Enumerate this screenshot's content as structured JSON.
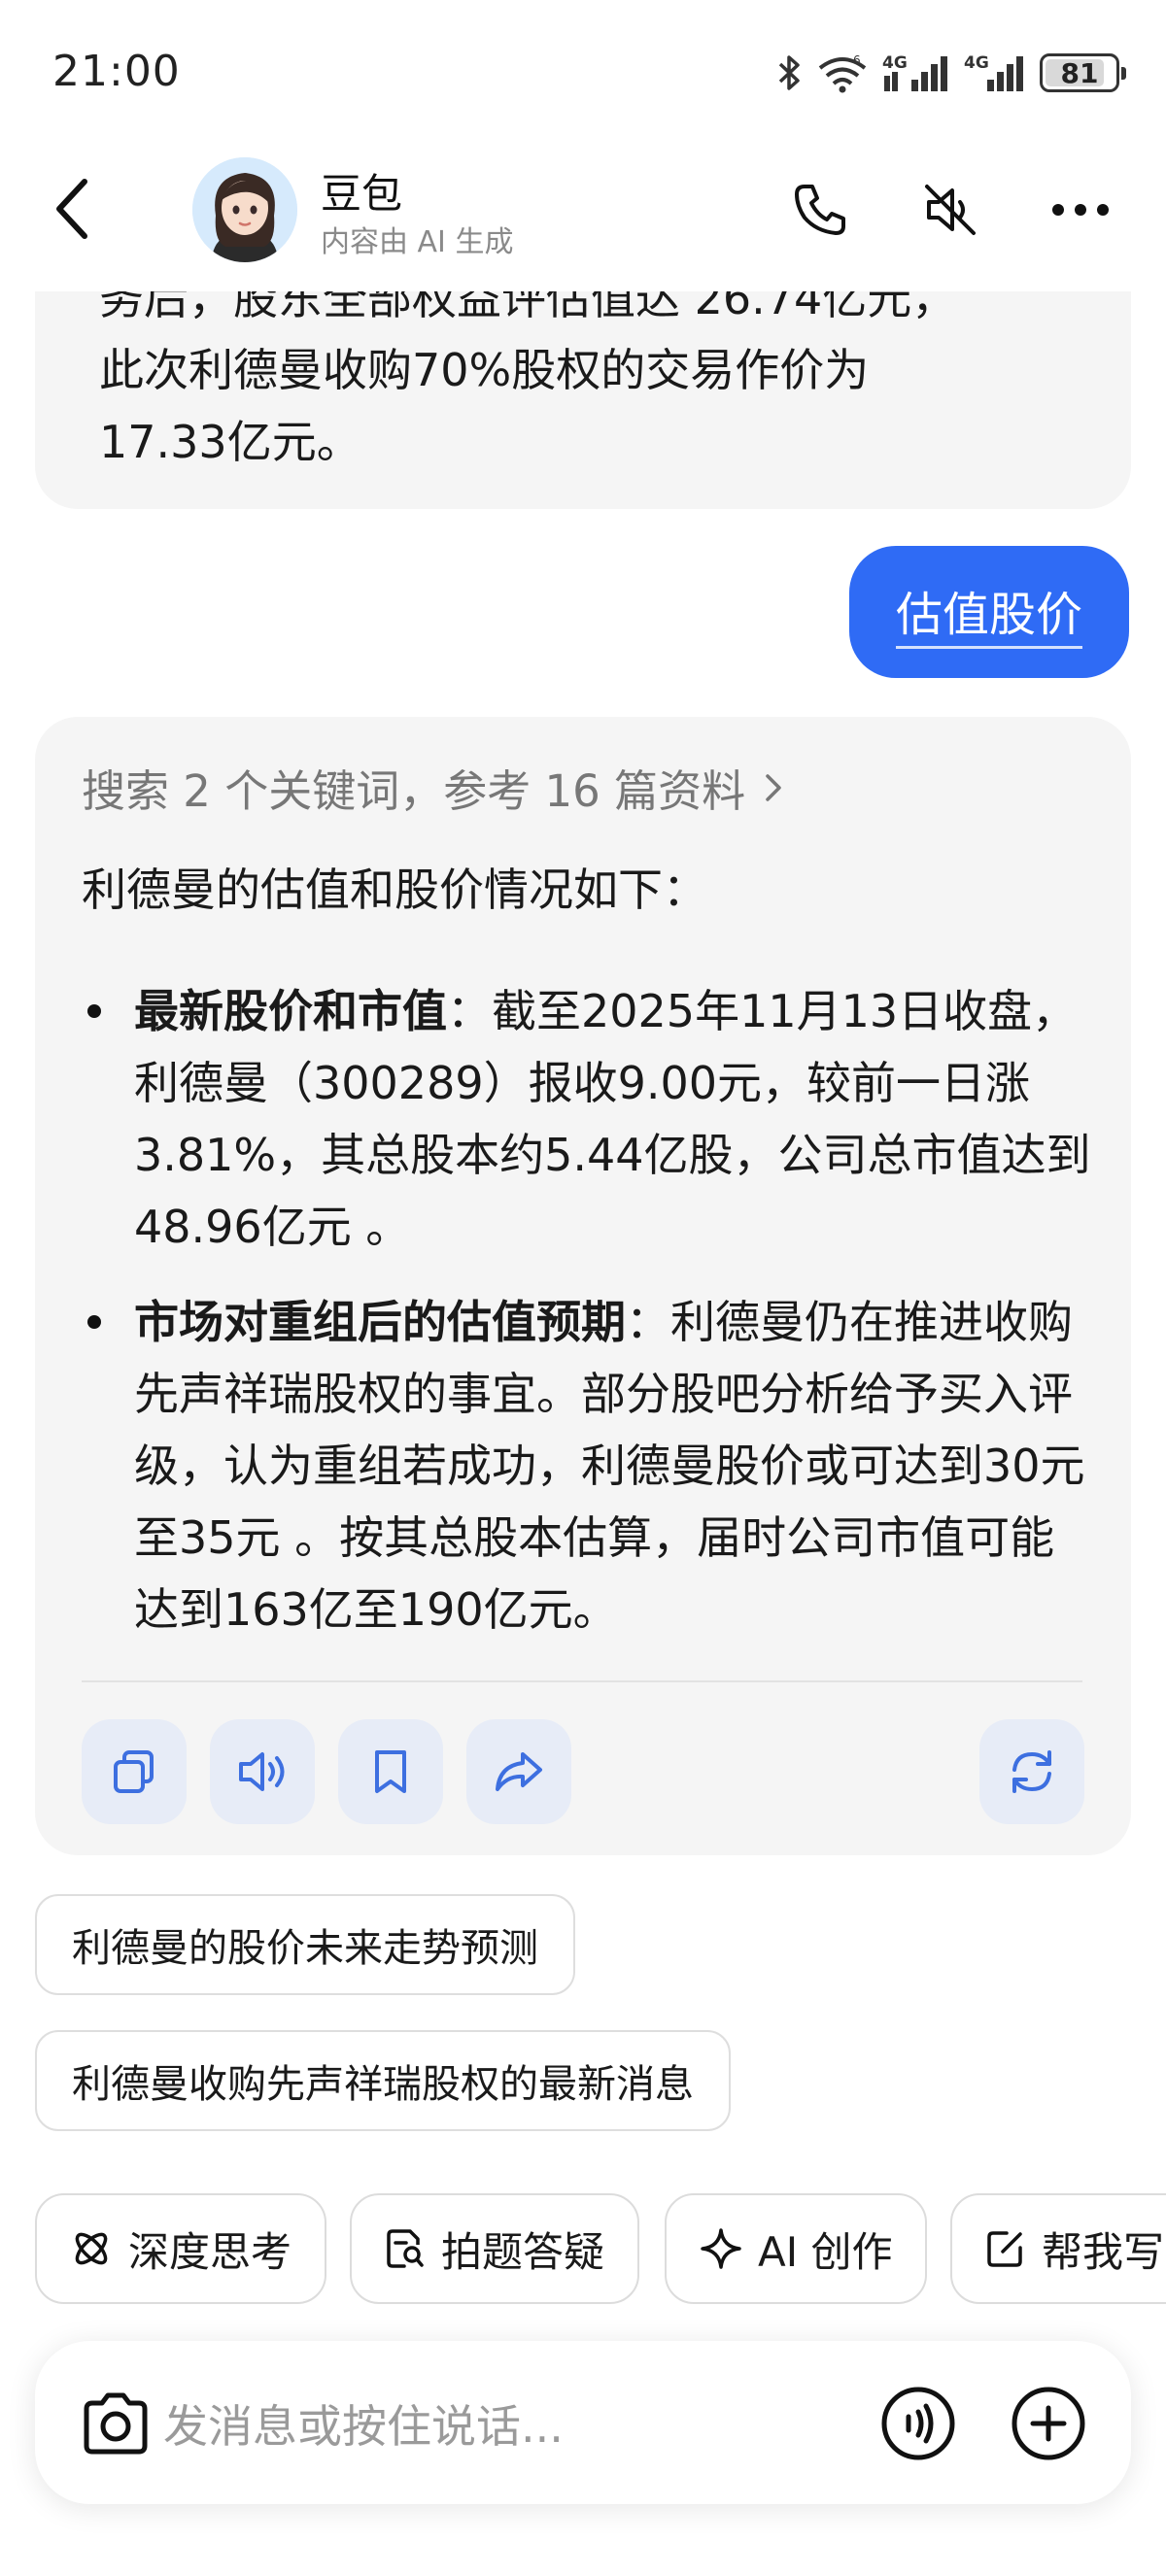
{
  "status_bar": {
    "time": "21:00",
    "battery_level": "81",
    "icons": [
      "bluetooth-icon",
      "wifi-icon",
      "signal-4g-icon",
      "signal-4g-icon",
      "battery-icon"
    ]
  },
  "header": {
    "title": "豆包",
    "subtitle": "内容由 AI 生成",
    "icons": [
      "back-icon",
      "phone-icon",
      "mute-icon",
      "more-icon"
    ]
  },
  "previous_message": {
    "lines": [
      "务后，股东全部权益评估值达 26.74亿元，",
      "此次利德曼收购70%股权的交易作价为",
      "17.33亿元。"
    ]
  },
  "user_message": "估值股价",
  "bot_reply": {
    "search_ref": "搜索 2 个关键词，参考 16 篇资料",
    "intro": "利德曼的估值和股价情况如下：",
    "items": [
      {
        "heading": "最新股价和市值",
        "text": "：截至2025年11月13日收盘，利德曼（300289）报收9.00元，较前一日涨3.81%，其总股本约5.44亿股，公司总市值达到48.96亿元 。"
      },
      {
        "heading": "市场对重组后的估值预期",
        "text": "：利德曼仍在推进收购先声祥瑞股权的事宜。部分股吧分析给予买入评级，认为重组若成功，利德曼股价或可达到30元至35元 。按其总股本估算，届时公司市值可能达到163亿至190亿元。"
      }
    ],
    "actions": [
      "copy-icon",
      "speaker-icon",
      "bookmark-icon",
      "share-icon",
      "regenerate-icon"
    ]
  },
  "suggestions": [
    "利德曼的股价未来走势预测",
    "利德曼收购先声祥瑞股权的最新消息"
  ],
  "tools": [
    {
      "label": "深度思考",
      "icon": "atom-icon"
    },
    {
      "label": "拍题答疑",
      "icon": "photo-search-icon"
    },
    {
      "label": "AI 创作",
      "icon": "sparkle-icon"
    },
    {
      "label": "帮我写",
      "icon": "edit-icon"
    }
  ],
  "input": {
    "placeholder": "发消息或按住说话..."
  },
  "colors": {
    "accent": "#2f6bf5",
    "bubble_bg": "#f5f5f5",
    "action_bg": "#e7ecf7",
    "action_icon": "#3d6fe0"
  }
}
